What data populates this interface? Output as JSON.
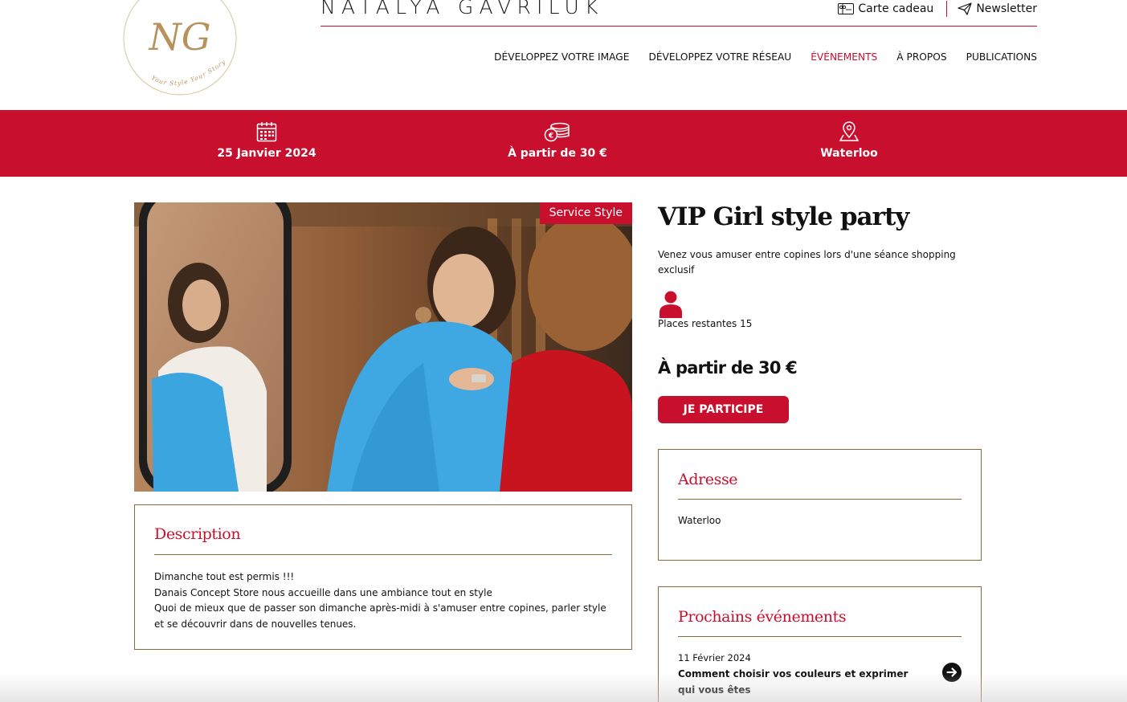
{
  "header": {
    "logo_monogram": "NG",
    "logo_tagline": "Your Style Your Story",
    "brand": "NATALYA GAVRILUK",
    "utility": {
      "gift_label": "Carte cadeau",
      "gift_icon": "gift-card-icon",
      "newsletter_label": "Newsletter",
      "newsletter_icon": "paper-plane-icon"
    },
    "nav": [
      {
        "label": "Développez votre image",
        "active": false
      },
      {
        "label": "Développez votre réseau",
        "active": false
      },
      {
        "label": "Événements",
        "active": true
      },
      {
        "label": "À propos",
        "active": false
      },
      {
        "label": "Publications",
        "active": false
      }
    ]
  },
  "infobar": {
    "date": {
      "text": "25 Janvier 2024",
      "icon": "calendar-icon"
    },
    "price": {
      "text": "À partir de 30 €",
      "icon": "coins-icon"
    },
    "location": {
      "text": "Waterloo",
      "icon": "map-pin-icon"
    }
  },
  "event": {
    "tag": "Service Style",
    "title": "VIP Girl style party",
    "subtitle": "Venez vous amuser entre copines lors d'une séance shopping exclusif",
    "places_label": "Places restantes 15",
    "price": "À partir de 30 €",
    "cta": "JE PARTICIPE"
  },
  "description": {
    "title": "Description",
    "lines": [
      "Dimanche tout est permis !!!",
      "Danais Concept Store nous accueille dans une ambiance tout en style",
      "Quoi de mieux que de passer son dimanche après-midi à s'amuser entre copines, parler style",
      "et se découvrir dans de nouvelles tenues."
    ]
  },
  "address": {
    "title": "Adresse",
    "text": "Waterloo"
  },
  "next_events": {
    "title": "Prochains événements",
    "items": [
      {
        "date": "11 Février 2024",
        "name": "Comment choisir vos couleurs et exprimer qui vous êtes"
      }
    ]
  },
  "colors": {
    "accent": "#c8102e",
    "border": "#8a6a3a",
    "gold": "#c6a063"
  }
}
